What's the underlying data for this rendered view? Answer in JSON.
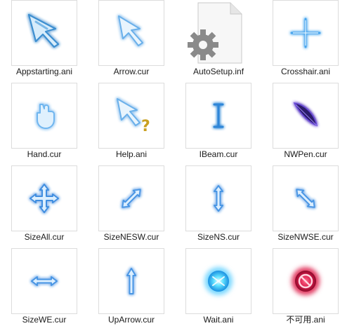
{
  "files": [
    {
      "name": "Appstarting.ani",
      "icon": "appstarting-cursor-icon"
    },
    {
      "name": "Arrow.cur",
      "icon": "arrow-cursor-icon"
    },
    {
      "name": "AutoSetup.inf",
      "icon": "settings-file-icon"
    },
    {
      "name": "Crosshair.ani",
      "icon": "crosshair-cursor-icon"
    },
    {
      "name": "Hand.cur",
      "icon": "hand-cursor-icon"
    },
    {
      "name": "Help.ani",
      "icon": "help-cursor-icon"
    },
    {
      "name": "IBeam.cur",
      "icon": "ibeam-cursor-icon"
    },
    {
      "name": "NWPen.cur",
      "icon": "pen-cursor-icon"
    },
    {
      "name": "SizeAll.cur",
      "icon": "sizeall-cursor-icon"
    },
    {
      "name": "SizeNESW.cur",
      "icon": "sizenesw-cursor-icon"
    },
    {
      "name": "SizeNS.cur",
      "icon": "sizens-cursor-icon"
    },
    {
      "name": "SizeNWSE.cur",
      "icon": "sizenwse-cursor-icon"
    },
    {
      "name": "SizeWE.cur",
      "icon": "sizewe-cursor-icon"
    },
    {
      "name": "UpArrow.cur",
      "icon": "uparrow-cursor-icon"
    },
    {
      "name": "Wait.ani",
      "icon": "wait-cursor-icon"
    },
    {
      "name": "不可用.ani",
      "icon": "unavailable-cursor-icon"
    }
  ]
}
